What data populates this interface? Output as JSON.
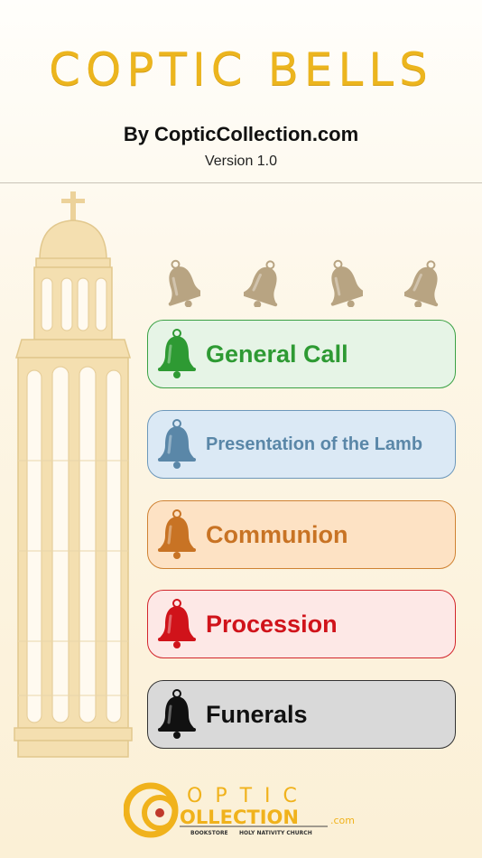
{
  "header": {
    "title": "Coptic Bells",
    "byline": "By CopticCollection.com",
    "version": "Version 1.0"
  },
  "bells": [
    {
      "label": "General Call",
      "color": "#2e9a33",
      "bg": "#e6f4e6",
      "border": "#3aa144",
      "icon": "bell-icon"
    },
    {
      "label": "Presentation of the Lamb",
      "color": "#5a87a8",
      "bg": "#dbe9f5",
      "border": "#6d98bb",
      "icon": "bell-icon"
    },
    {
      "label": "Communion",
      "color": "#c87324",
      "bg": "#fde2c4",
      "border": "#cf8233",
      "icon": "bell-icon"
    },
    {
      "label": "Procession",
      "color": "#d0131a",
      "bg": "#fde8e6",
      "border": "#d2262c",
      "icon": "bell-icon"
    },
    {
      "label": "Funerals",
      "color": "#111111",
      "bg": "#d9d9d9",
      "border": "#333333",
      "icon": "bell-icon"
    }
  ],
  "top_bells_color": "#b8a482",
  "footer": {
    "logo_word1": "OPTIC",
    "logo_word2": "OLLECTION",
    "logo_suffix": ".com",
    "logo_tagline_left": "BOOKSTORE",
    "logo_tagline_right": "HOLY NATIVITY CHURCH",
    "logo_color": "#f0b21c",
    "logo_accent": "#c0392b"
  }
}
